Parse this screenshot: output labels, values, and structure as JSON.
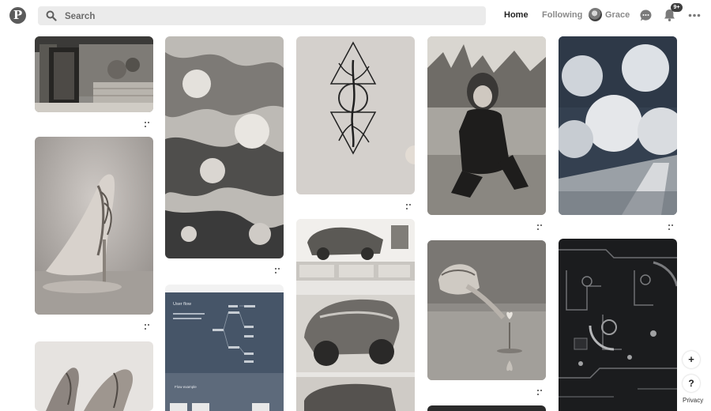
{
  "header": {
    "logo_letter": "P",
    "search": {
      "placeholder": "Search",
      "value": ""
    },
    "nav": {
      "home": "Home",
      "following": "Following"
    },
    "profile": {
      "name": "Grace"
    },
    "notifications_badge": "9+",
    "icons": [
      "pinterest-logo-icon",
      "search-icon",
      "chat-bubble-icon",
      "bell-icon",
      "more-options-icon"
    ]
  },
  "pins": [
    {
      "name": "pin-stone-doorway",
      "column": 1
    },
    {
      "name": "pin-silver-high-heel",
      "column": 1
    },
    {
      "name": "pin-heels-pair",
      "column": 1
    },
    {
      "name": "pin-floral-texture",
      "column": 2
    },
    {
      "name": "pin-user-flow-board",
      "column": 2
    },
    {
      "name": "pin-tree-triangle-drawing",
      "column": 3
    },
    {
      "name": "pin-vehicle-concept-sketches",
      "column": 3
    },
    {
      "name": "pin-girl-crouching",
      "column": 4
    },
    {
      "name": "pin-child-flower-water",
      "column": 4
    },
    {
      "name": "pin-white-trees-path",
      "column": 5
    },
    {
      "name": "pin-circuit-pattern",
      "column": 5
    }
  ],
  "user_flow_board": {
    "title": "User flow",
    "subtitle": "Flow example"
  },
  "floating": {
    "add": "+",
    "help": "?",
    "privacy": "Privacy"
  }
}
